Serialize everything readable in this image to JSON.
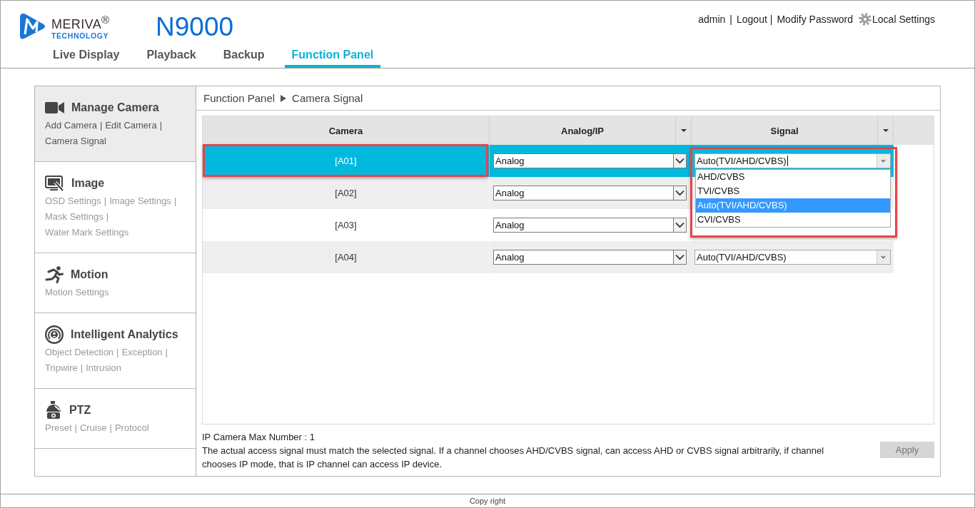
{
  "header": {
    "logo": {
      "name": "MERIVA$^{®}$",
      "tagline": "TECHNOLOGY"
    },
    "model": "N9000",
    "user_links": [
      {
        "label": "admin",
        "kind": "user",
        "separator": "|"
      },
      {
        "label": "Logout",
        "kind": "link",
        "separator": "|"
      },
      {
        "label": "Modify Password",
        "kind": "link"
      },
      {
        "label": "Local Settings",
        "kind": "settings"
      }
    ]
  },
  "tabs": [
    {
      "label": "Live Display",
      "selected": false
    },
    {
      "label": "Playback",
      "selected": false
    },
    {
      "label": "Backup",
      "selected": false
    },
    {
      "label": "Function Panel",
      "selected": true
    }
  ],
  "sidebar": {
    "items": [
      {
        "title": "Manage Camera",
        "selected": true,
        "links": [
          {
            "label": "Add Camera",
            "separator": "|"
          },
          {
            "label": "Edit Camera",
            "separator": "|"
          },
          {
            "label": "Camera Signal"
          }
        ]
      },
      {
        "title": "Image",
        "selected": false,
        "links": [
          {
            "label": "OSD Settings",
            "separator": "|"
          },
          {
            "label": "Image Settings",
            "separator": "|"
          },
          {
            "label": "Mask Settings",
            "separator": "|"
          },
          {
            "label": "Water Mark Settings"
          }
        ]
      },
      {
        "title": "Motion",
        "selected": false,
        "links": [
          {
            "label": "Motion Settings"
          }
        ]
      },
      {
        "title": "Intelligent Analytics",
        "selected": false,
        "links": [
          {
            "label": "Object Detection",
            "separator": "|"
          },
          {
            "label": "Exception",
            "separator": "|"
          },
          {
            "label": "Tripwire",
            "separator": "|"
          },
          {
            "label": "Intrusion"
          }
        ]
      },
      {
        "title": "PTZ",
        "selected": false,
        "links": [
          {
            "label": "Preset",
            "separator": "|"
          },
          {
            "label": "Cruise",
            "separator": "|"
          },
          {
            "label": "Protocol"
          }
        ]
      }
    ]
  },
  "breadcrumb": {
    "items": [
      "Function Panel",
      "Camera Signal"
    ]
  },
  "table": {
    "columns": [
      {
        "label": "Camera",
        "menu": false
      },
      {
        "label": "Analog/IP",
        "menu": true
      },
      {
        "label": "Signal",
        "menu": true
      }
    ],
    "rows": [
      {
        "camera": "[A01]",
        "selected": true,
        "camera_marked": true,
        "mode": "Analog",
        "signal": {
          "value": "Auto(TVI/AHD/CVBS)",
          "focused": true,
          "open": true,
          "marked": true,
          "options": [
            {
              "label": "AHD/CVBS",
              "selected": false
            },
            {
              "label": "TVI/CVBS",
              "selected": false
            },
            {
              "label": "Auto(TVI/AHD/CVBS)",
              "selected": true
            },
            {
              "label": "CVI/CVBS",
              "selected": false
            }
          ]
        }
      },
      {
        "camera": "[A02]",
        "selected": false,
        "camera_marked": false,
        "mode": "Analog"
      },
      {
        "camera": "[A03]",
        "selected": false,
        "camera_marked": false,
        "mode": "Analog"
      },
      {
        "camera": "[A04]",
        "selected": false,
        "camera_marked": false,
        "mode": "Analog",
        "signal": {
          "value": "Auto(TVI/AHD/CVBS)",
          "focused": false,
          "open": false,
          "marked": false
        }
      }
    ]
  },
  "info": {
    "max_number": "IP Camera Max Number : 1",
    "note": "The actual access signal must match the selected signal. If a channel chooses AHD/CVBS signal, can access AHD or CVBS signal arbitrarily, if channel chooses IP mode, that is IP channel can access IP device."
  },
  "apply_button": {
    "label": "Apply",
    "disabled": true
  },
  "footer": {
    "text": "Copy right"
  }
}
